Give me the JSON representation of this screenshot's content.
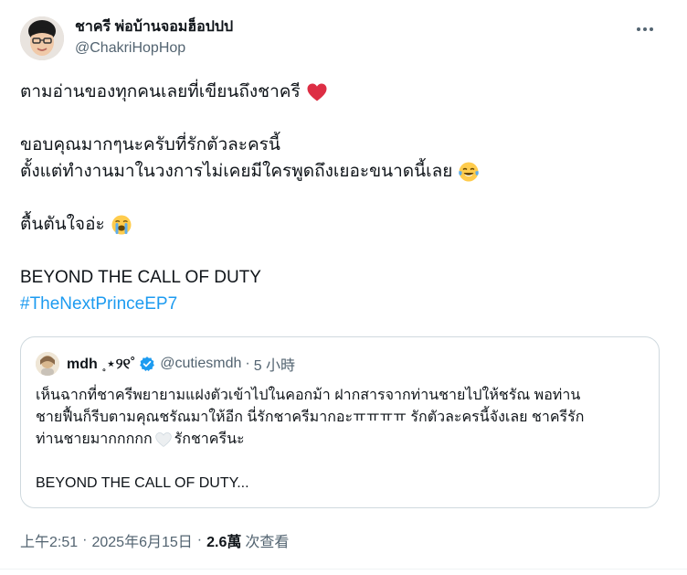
{
  "author": {
    "display_name": "ชาครี พ่อบ้านจอมฮ็อปปป",
    "handle": "@ChakriHopHop"
  },
  "tweet": {
    "lines": [
      "ตามอ่านของทุกคนเลยที่เขียนถึงชาครี",
      "ขอบคุณมากๆนะครับที่รักตัวละครนี้",
      "ตั้งแต่ทำงานมาในวงการไม่เคยมีใครพูดถึงเยอะขนาดนี้เลย",
      "ตื้นตันใจอ่ะ",
      "BEYOND THE CALL OF DUTY"
    ],
    "hashtag": "#TheNextPrinceEP7",
    "emojis": [
      "red-heart",
      "tears-of-joy",
      "loudly-crying-face"
    ]
  },
  "quote": {
    "display_name": "mdh ˳⋆୨୧˚",
    "handle": "@cutiesmdh",
    "separator": "·",
    "time": "5 小時",
    "lines": [
      "เห็นฉากที่ชาครีพยายามแฝงตัวเข้าไปในคอกม้า ฝากสารจากท่านชายไปให้ชรัณ พอท่าน",
      "ชายฟื้นก็รีบตามคุณชรัณมาให้อีก นี่รักชาครีมากอะㅠㅠㅠㅠ รักตัวละครนี้จังเลย ชาครีรัก",
      "ท่านชายมากกกกก",
      "รักชาครีนะ",
      "BEYOND THE CALL OF DUTY..."
    ],
    "emoji": "white-heart"
  },
  "meta": {
    "time": "上午2:51",
    "date": "2025年6月15日",
    "separator": "·",
    "views_count": "2.6萬",
    "views_label": "次查看"
  },
  "colors": {
    "text": "#0f1419",
    "secondary": "#536471",
    "link": "#1d9bf0",
    "border": "#cfd9de",
    "verified": "#1d9bf0"
  }
}
